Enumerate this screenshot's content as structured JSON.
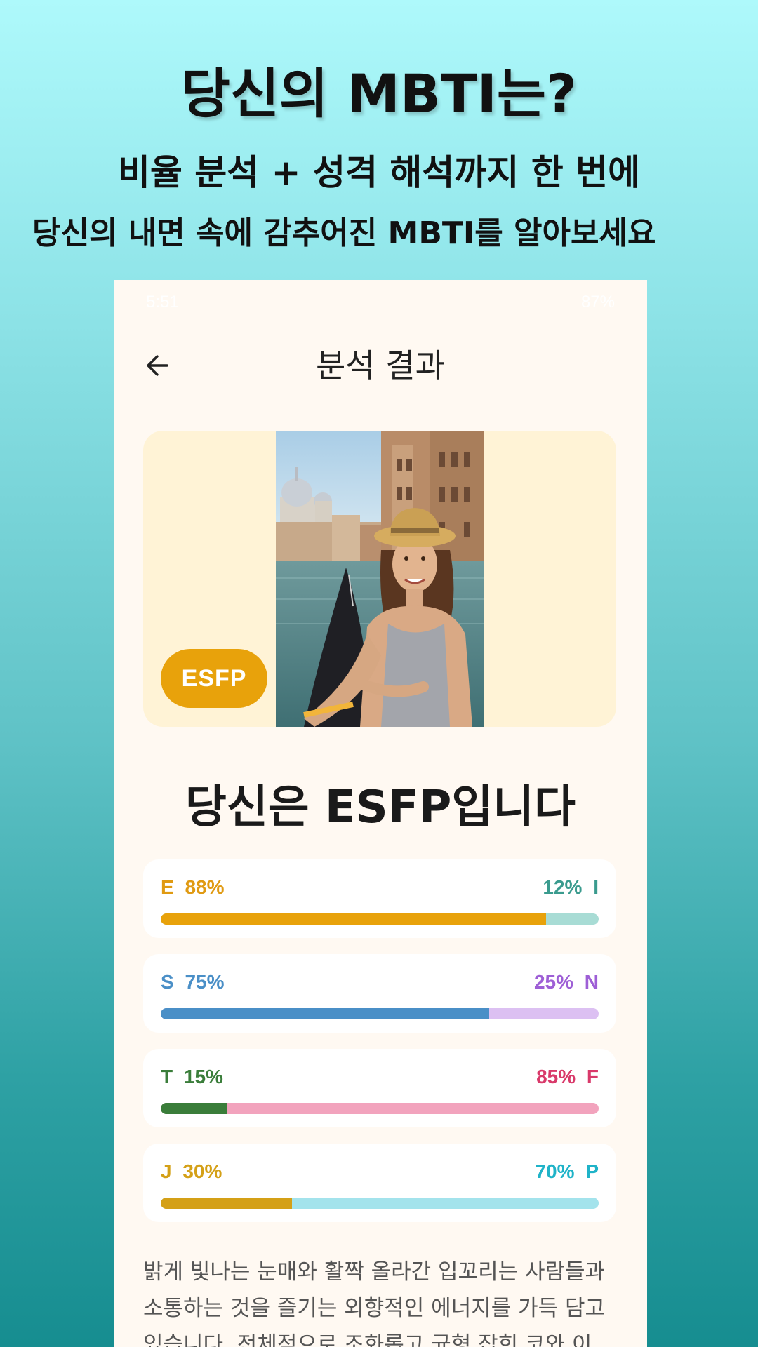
{
  "promo": {
    "title": "당신의 MBTI는?",
    "subtitle1": "비율 분석 + 성격 해석까지 한 번에",
    "subtitle2": "당신의 내면 속에 감추어진 MBTI를 알아보세요"
  },
  "status_bar": {
    "time": "5:51",
    "right": "87%"
  },
  "app_bar": {
    "title": "분석 결과",
    "back_icon": "arrow-left-icon"
  },
  "result": {
    "type_badge": "ESFP",
    "heading": "당신은 ESFP입니다"
  },
  "dimensions": [
    {
      "left_letter": "E",
      "left_pct": "88%",
      "right_pct": "12%",
      "right_letter": "I",
      "left_value": 88,
      "left_color": "#e8a20b",
      "right_color": "#a8dcd5",
      "left_text_color": "#e09a12",
      "right_text_color": "#3a9b8e"
    },
    {
      "left_letter": "S",
      "left_pct": "75%",
      "right_pct": "25%",
      "right_letter": "N",
      "left_value": 75,
      "left_color": "#4a8fc7",
      "right_color": "#dcc0f2",
      "left_text_color": "#4a8fc7",
      "right_text_color": "#9e5fd6"
    },
    {
      "left_letter": "T",
      "left_pct": "15%",
      "right_pct": "85%",
      "right_letter": "F",
      "left_value": 15,
      "left_color": "#3a7d3a",
      "right_color": "#f2a3bd",
      "left_text_color": "#3a7d3a",
      "right_text_color": "#d9396a"
    },
    {
      "left_letter": "J",
      "left_pct": "30%",
      "right_pct": "70%",
      "right_letter": "P",
      "left_value": 30,
      "left_color": "#d4a017",
      "right_color": "#a3e3ec",
      "left_text_color": "#d4a017",
      "right_text_color": "#1fb3c8"
    }
  ],
  "description": "밝게 빛나는 눈매와 활짝 올라간 입꼬리는 사람들과 소통하는 것을 즐기는 외향적인 에너지를 가득 담고 있습니다. 전체적으로 조화롭고 균형 잡힌 코와 이"
}
